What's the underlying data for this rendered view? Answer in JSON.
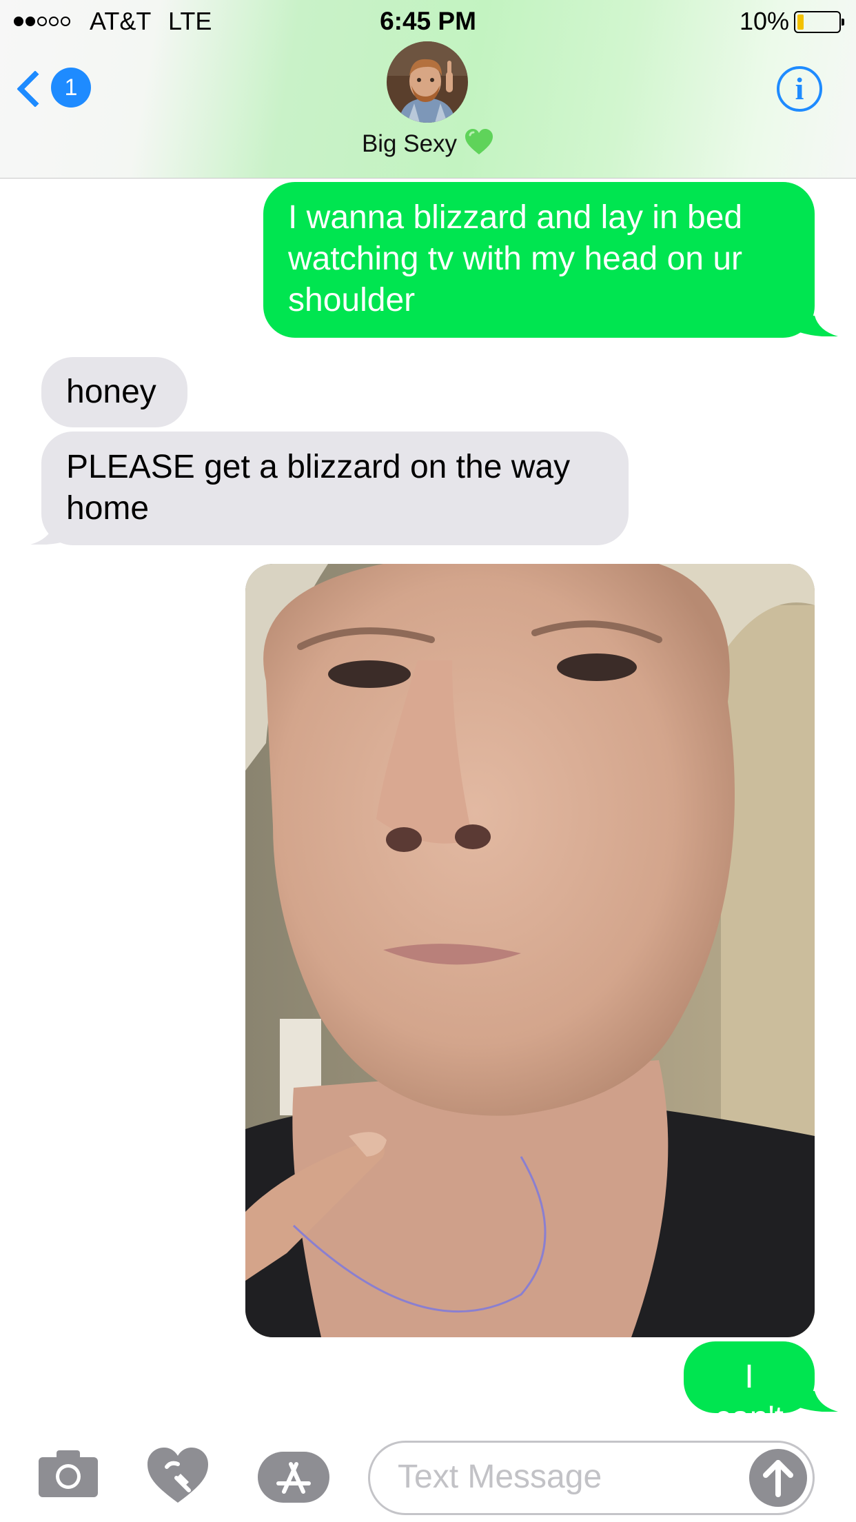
{
  "status_bar": {
    "signal_bars": 5,
    "signal_filled": 2,
    "carrier": "AT&T",
    "network": "LTE",
    "time": "6:45 PM",
    "battery_percent_label": "10%",
    "battery_level": 0.1,
    "battery_color": "#f3c200"
  },
  "nav": {
    "back_icon": "chevron-left-icon",
    "unread_count": "1",
    "contact_name": "Big Sexy",
    "contact_emoji": "green-heart",
    "info_icon": "info-icon",
    "info_glyph": "i"
  },
  "colors": {
    "accent": "#1e8bff",
    "outgoing_bubble": "#00e550",
    "incoming_bubble": "#e6e5ea"
  },
  "messages": [
    {
      "direction": "outgoing",
      "type": "text",
      "text": "I wanna blizzard and lay in bed watching tv with my head on ur shoulder"
    },
    {
      "direction": "incoming",
      "type": "text",
      "text": "honey"
    },
    {
      "direction": "incoming",
      "type": "text",
      "text": "PLEASE get a blizzard on the way home"
    },
    {
      "direction": "outgoing",
      "type": "image",
      "description_icon": "photo-attachment"
    },
    {
      "direction": "outgoing",
      "type": "text",
      "text": "I can't"
    }
  ],
  "input_bar": {
    "camera_icon": "camera-icon",
    "digital_touch_icon": "heart-touch-icon",
    "apps_icon": "app-store-icon",
    "placeholder": "Text Message",
    "send_icon": "arrow-up-icon"
  }
}
